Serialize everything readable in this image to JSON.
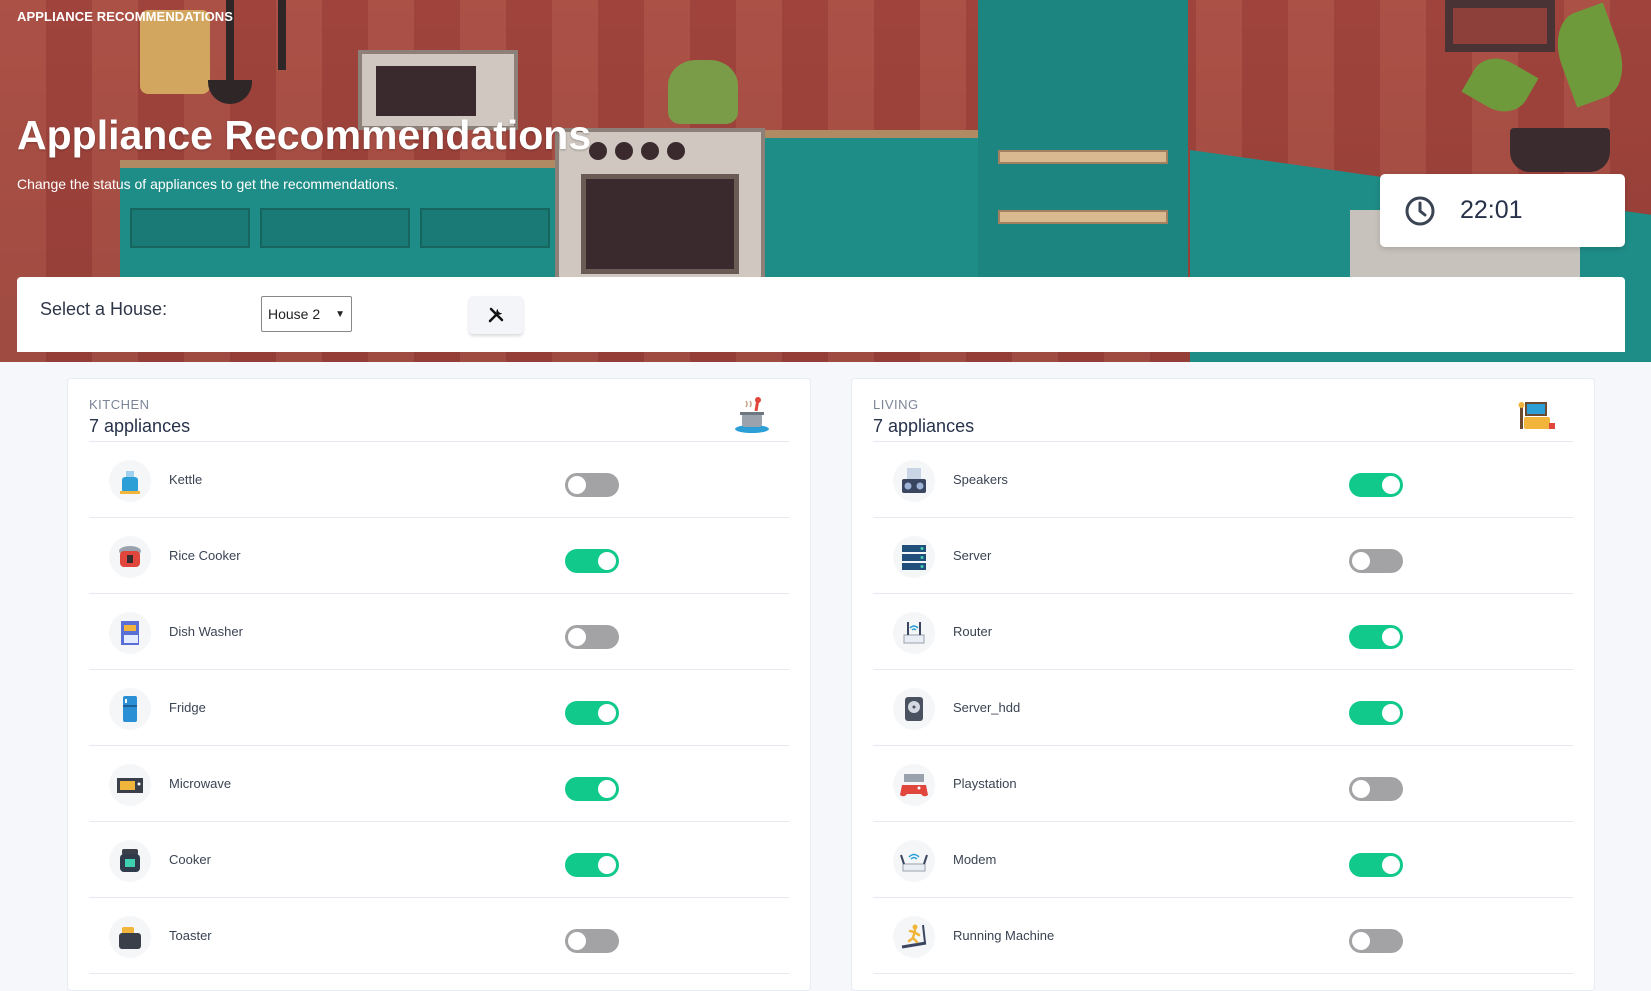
{
  "header": {
    "app_label": "APPLIANCE RECOMMENDATIONS",
    "title": "Appliance Recommendations",
    "subtitle": "Change the status of appliances to get the recommendations."
  },
  "clock": {
    "icon": "clock-icon",
    "time": "22:01"
  },
  "house_select": {
    "label": "Select a House:",
    "selected": "House 2",
    "tool_button_icon": "tools-icon"
  },
  "colors": {
    "toggle_on": "#12c98c",
    "toggle_off": "#a3a3a6",
    "hero_teal": "#1f8d87"
  },
  "rooms": [
    {
      "category": "KITCHEN",
      "count_label": "7 appliances",
      "icon": "stove-pot-icon",
      "appliances": [
        {
          "name": "Kettle",
          "icon": "kettle-icon",
          "on": false
        },
        {
          "name": "Rice Cooker",
          "icon": "rice-cooker-icon",
          "on": true
        },
        {
          "name": "Dish Washer",
          "icon": "dish-washer-icon",
          "on": false
        },
        {
          "name": "Fridge",
          "icon": "fridge-icon",
          "on": true
        },
        {
          "name": "Microwave",
          "icon": "microwave-icon",
          "on": true
        },
        {
          "name": "Cooker",
          "icon": "cooker-icon",
          "on": true
        },
        {
          "name": "Toaster",
          "icon": "toaster-icon",
          "on": false
        }
      ]
    },
    {
      "category": "LIVING",
      "count_label": "7 appliances",
      "icon": "living-room-icon",
      "appliances": [
        {
          "name": "Speakers",
          "icon": "speakers-icon",
          "on": true
        },
        {
          "name": "Server",
          "icon": "server-icon",
          "on": false
        },
        {
          "name": "Router",
          "icon": "router-icon",
          "on": true
        },
        {
          "name": "Server_hdd",
          "icon": "hdd-icon",
          "on": true
        },
        {
          "name": "Playstation",
          "icon": "gamepad-icon",
          "on": false
        },
        {
          "name": "Modem",
          "icon": "modem-icon",
          "on": true
        },
        {
          "name": "Running Machine",
          "icon": "treadmill-icon",
          "on": false
        }
      ]
    }
  ]
}
